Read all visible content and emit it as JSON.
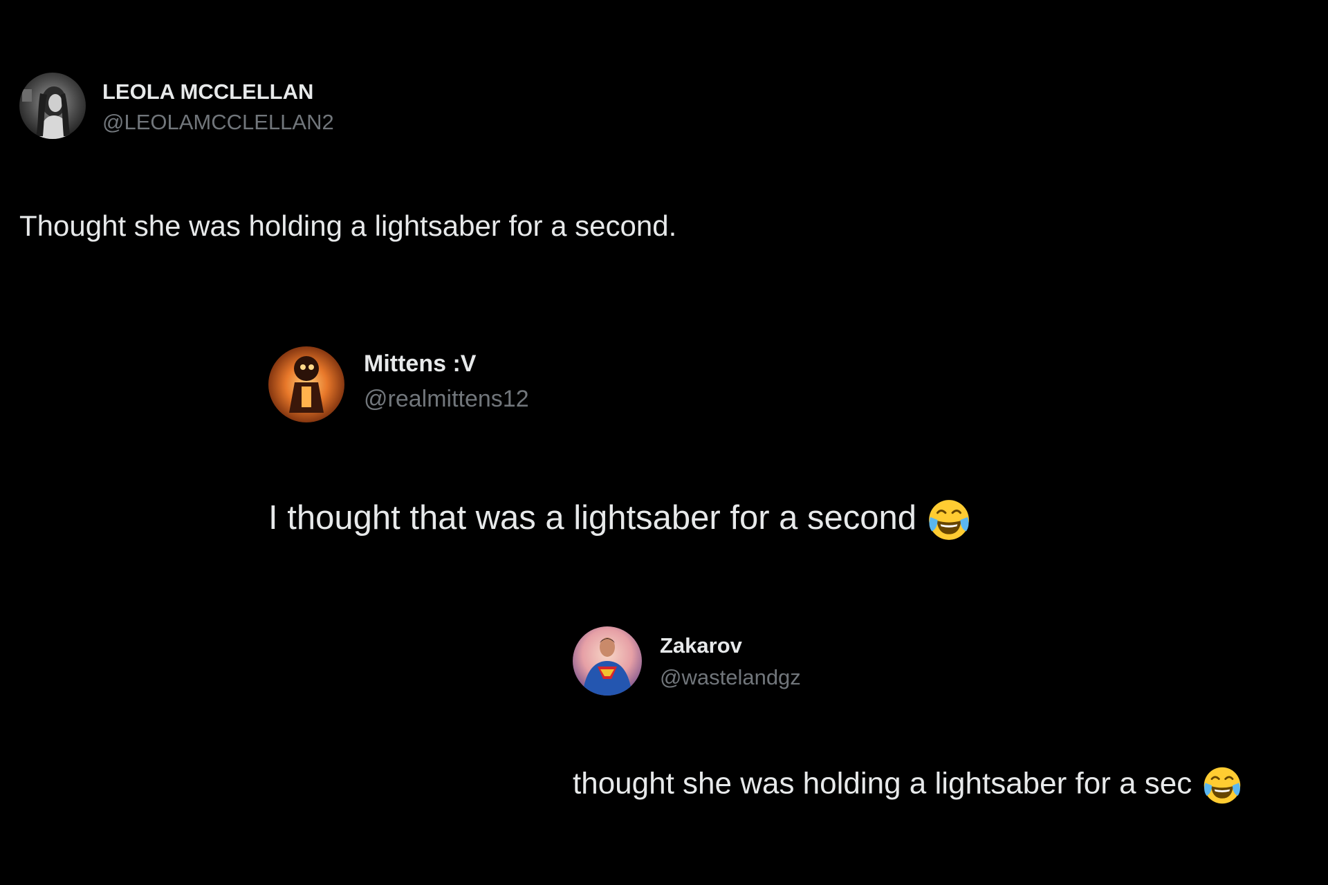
{
  "thread": [
    {
      "display_name": "LEOLA MCCLELLAN",
      "handle": "@LEOLAMCCLELLAN2",
      "avatar_icon": "user-photo-avatar",
      "text": "Thought she was holding a lightsaber for a second.",
      "emoji": ""
    },
    {
      "display_name": "Mittens :V",
      "handle": "@realmittens12",
      "avatar_icon": "glowing-figure-avatar",
      "text": "I thought that was a lightsaber for a second",
      "emoji": "face-with-tears-of-joy"
    },
    {
      "display_name": "Zakarov",
      "handle": "@wastelandgz",
      "avatar_icon": "superhero-avatar",
      "text": "thought she was holding a lightsaber for a sec",
      "emoji": "face-with-tears-of-joy"
    }
  ],
  "colors": {
    "background": "#000000",
    "primary_text": "#e7e9ea",
    "secondary_text": "#71767b"
  }
}
